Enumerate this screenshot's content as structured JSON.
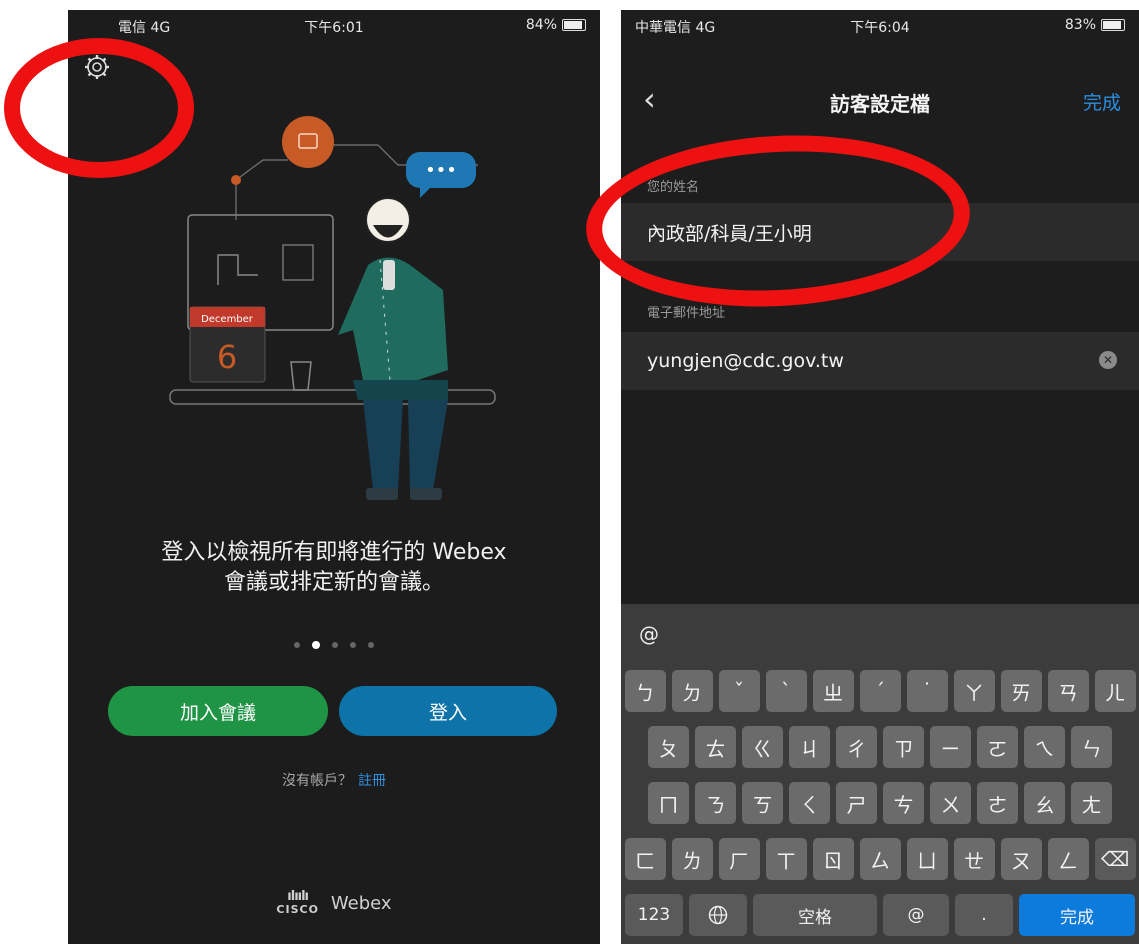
{
  "left_screen": {
    "status": {
      "carrier": "電信 4G",
      "time": "下午6:01",
      "battery": "84%"
    },
    "illustration": {
      "calendar_month": "December",
      "calendar_day": "6",
      "bubble_text": "•••"
    },
    "promo_line1": "登入以檢視所有即將進行的 Webex",
    "promo_line2": "會議或排定新的會議。",
    "carousel": {
      "count": 5,
      "active_index": 1
    },
    "join_label": "加入會議",
    "signin_label": "登入",
    "no_account_text": "沒有帳戶？",
    "register_label": "註冊",
    "brand": {
      "bars": "ılıılı",
      "cisco": "CISCO",
      "product": "Webex"
    }
  },
  "right_screen": {
    "status": {
      "carrier": "中華電信 4G",
      "time": "下午6:04",
      "battery": "83%"
    },
    "nav": {
      "back_icon": "chevron-left-icon",
      "title": "訪客設定檔",
      "done_label": "完成"
    },
    "name_field": {
      "label": "您的姓名",
      "value": "內政部/科員/王小明"
    },
    "email_field": {
      "label": "電子郵件地址",
      "value": "yungjen@cdc.gov.tw"
    },
    "keyboard": {
      "suggestion": "@",
      "row1": [
        "ㄅ",
        "ㄉ",
        "ˇ",
        "ˋ",
        "ㄓ",
        "ˊ",
        "˙",
        "ㄚ",
        "ㄞ",
        "ㄢ",
        "ㄦ"
      ],
      "row2": [
        "ㄆ",
        "ㄊ",
        "ㄍ",
        "ㄐ",
        "ㄔ",
        "ㄗ",
        "ㄧ",
        "ㄛ",
        "ㄟ",
        "ㄣ"
      ],
      "row3": [
        "ㄇ",
        "ㄋ",
        "ㄎ",
        "ㄑ",
        "ㄕ",
        "ㄘ",
        "ㄨ",
        "ㄜ",
        "ㄠ",
        "ㄤ"
      ],
      "row4": [
        "ㄈ",
        "ㄌ",
        "ㄏ",
        "ㄒ",
        "ㄖ",
        "ㄙ",
        "ㄩ",
        "ㄝ",
        "ㄡ",
        "ㄥ"
      ],
      "backspace": "⌫",
      "numbers_label": "123",
      "globe_icon": "globe-icon",
      "space_label": "空格",
      "at_label": "@",
      "dot_label": ".",
      "return_label": "完成"
    }
  },
  "colors": {
    "annotation_ring": "#ee1111",
    "join": "#1f9444",
    "signin": "#0d73a8",
    "link": "#2a8ee0"
  }
}
